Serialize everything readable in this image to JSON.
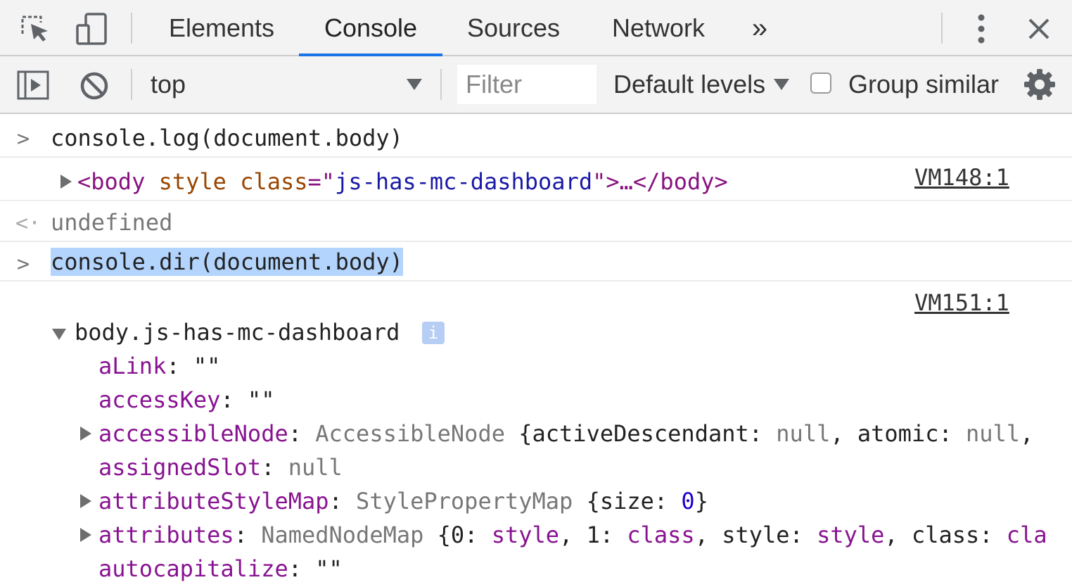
{
  "tabs": {
    "elements": "Elements",
    "console": "Console",
    "sources": "Sources",
    "network": "Network",
    "more": "»"
  },
  "icons": {
    "inspect": "inspect-element-icon",
    "device": "device-toolbar-icon",
    "menu": "kebab-menu-icon",
    "close": "close-icon",
    "sidebar": "show-sidebar-icon",
    "clear": "clear-console-icon",
    "settings": "gear-icon"
  },
  "toolbar": {
    "context": "top",
    "filter_placeholder": "Filter",
    "levels": "Default levels",
    "group_similar": "Group similar",
    "group_similar_checked": false
  },
  "colors": {
    "active_tab_accent": "#1a73e8",
    "selection": "#b3d4fd",
    "property_name": "#881391",
    "tag_name": "#881280",
    "attribute_name": "#994500",
    "attribute_value": "#1a1aa6",
    "number": "#1c00cf"
  },
  "console": {
    "entries": [
      {
        "type": "input",
        "text": "console.log(document.body)"
      },
      {
        "type": "log",
        "source": "VM148:1",
        "open": "<",
        "tag": "body",
        "attr1": "style",
        "attr2": "class",
        "eq": "=\"",
        "value": "js-has-mc-dashboard",
        "close_quote": "\">…</",
        "tag_end": "body",
        "gt": ">"
      },
      {
        "type": "result",
        "text": "undefined"
      },
      {
        "type": "input",
        "text": "console.dir(document.body)"
      },
      {
        "type": "dir",
        "source": "VM151:1",
        "root": "body.js-has-mc-dashboard",
        "info": "i",
        "props": [
          {
            "name": "aLink",
            "colon": ":",
            "value": " \"\""
          },
          {
            "name": "accessKey",
            "colon": ":",
            "value": " \"\""
          },
          {
            "name": "accessibleNode",
            "colon": ":",
            "type": "AccessibleNode",
            "value": " {activeDescendant: ",
            "v1": "null",
            "v1sep": ", atomic: ",
            "v2": "null",
            "tail": ","
          },
          {
            "name": "assignedSlot",
            "colon": ":",
            "value": " ",
            "v1": "null"
          },
          {
            "name": "attributeStyleMap",
            "colon": ":",
            "type": "StylePropertyMap",
            "value": " {size: ",
            "v1": "0",
            "tail": "}"
          },
          {
            "name": "attributes",
            "colon": ":",
            "type": "NamedNodeMap",
            "value": " {0: ",
            "v1": "style",
            "v1sep": ", 1: ",
            "v2": "class",
            "v2sep": ", style: ",
            "v3": "style",
            "v3sep": ", class: ",
            "v4": "cla"
          },
          {
            "name": "autocapitalize",
            "colon": ":",
            "value": " \"\""
          }
        ]
      }
    ]
  }
}
